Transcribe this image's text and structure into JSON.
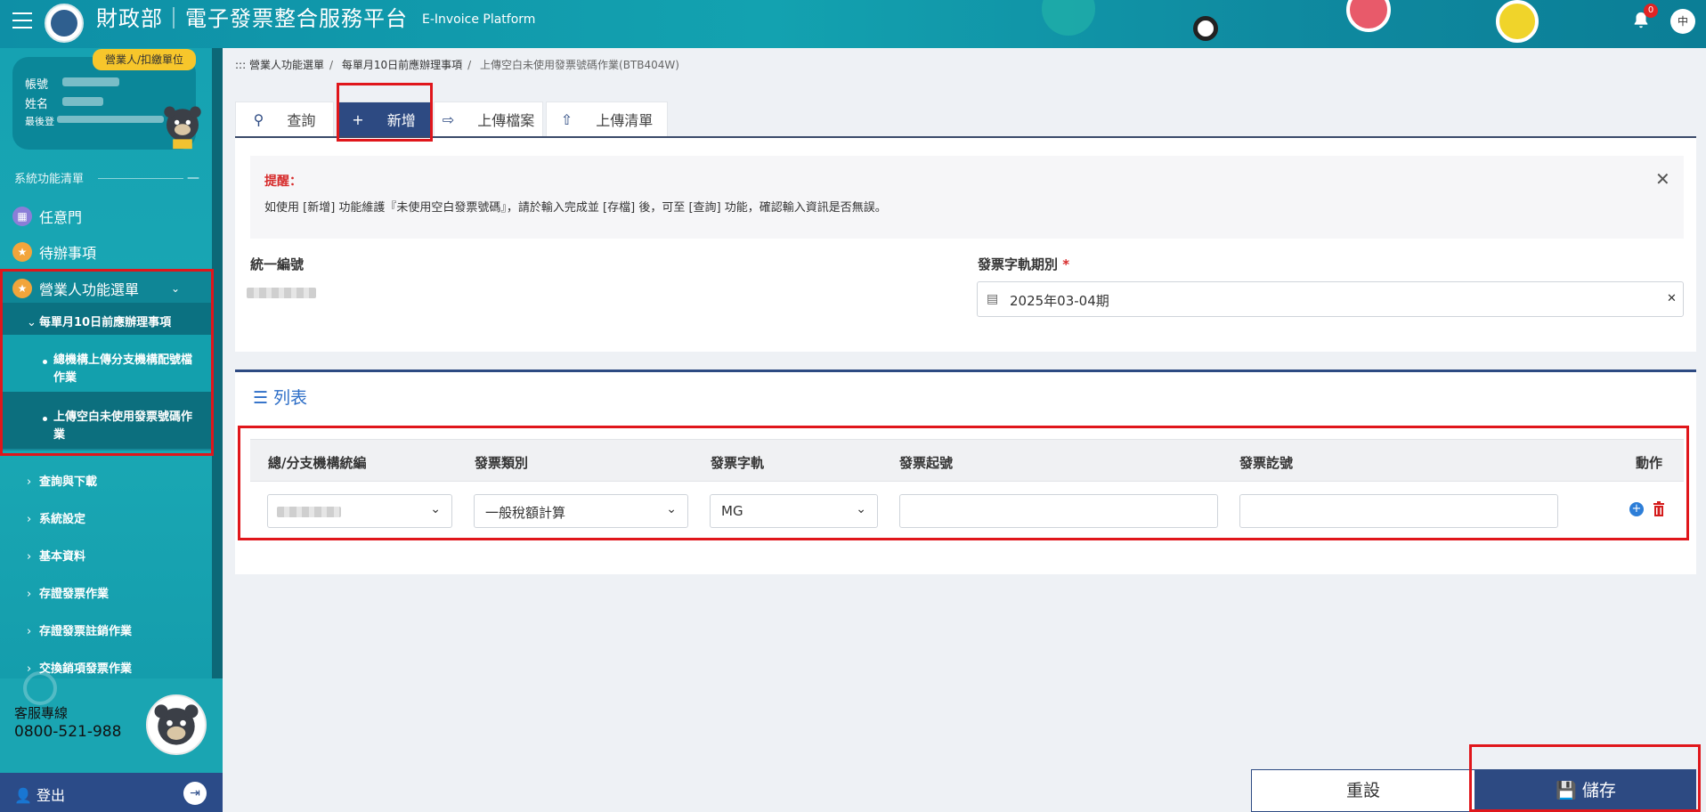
{
  "header": {
    "brand": "財政部｜電子發票整合服務平台",
    "brand_en": "E-Invoice Platform",
    "notif_count": "0",
    "lang": "中"
  },
  "sidebar": {
    "role_badge": "營業人/扣繳單位",
    "account_label": "帳號",
    "name_label": "姓名",
    "lastlogin_label": "最後登",
    "section_title": "系統功能清單",
    "section_toggle": "—",
    "items": {
      "any_door": "任意門",
      "todo": "待辦事項",
      "biz_menu": "營業人功能選單",
      "monthly": "每單月10日前應辦理事項",
      "sub1": "總機構上傳分支機構配號檔作業",
      "sub2": "上傳空白未使用發票號碼作業",
      "query_download": "查詢與下載",
      "settings": "系統設定",
      "basic": "基本資料",
      "proof_invoice": "存證發票作業",
      "proof_cancel": "存證發票註銷作業",
      "exchange": "交換銷項發票作業"
    },
    "hotline_label": "客服專線",
    "hotline_number": "0800-521-988",
    "logout": "登出"
  },
  "breadcrumb": {
    "prefix": ":::",
    "c1": "營業人功能選單",
    "c2": "每單月10日前應辦理事項",
    "c3": "上傳空白未使用發票號碼作業(BTB404W)"
  },
  "tabs": {
    "query": "查詢",
    "add": "新增",
    "upload_file": "上傳檔案",
    "upload_list": "上傳清單"
  },
  "notice": {
    "title": "提醒：",
    "text": "如使用 [新增] 功能維護『未使用空白發票號碼』，請於輸入完成並 [存檔] 後，可至 [查詢] 功能，確認輸入資訊是否無誤。"
  },
  "form": {
    "ubn_label": "統一編號",
    "period_label": "發票字軌期別",
    "period_required": "*",
    "period_value": "2025年03-04期"
  },
  "list": {
    "title": "列表",
    "columns": [
      "總/分支機構統編",
      "發票類別",
      "發票字軌",
      "發票起號",
      "發票訖號",
      "動作"
    ],
    "row": {
      "category": "一般稅額計算",
      "track": "MG",
      "start_no": "",
      "end_no": ""
    }
  },
  "buttons": {
    "reset": "重設",
    "save": "儲存"
  },
  "colors": {
    "primary": "#2d4a82",
    "teal": "#16a2b2",
    "highlight": "#e0161b"
  }
}
